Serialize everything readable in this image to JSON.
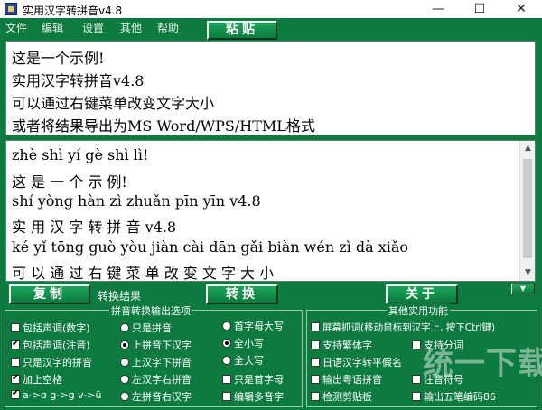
{
  "window": {
    "title": "实用汉字转拼音v4.8",
    "minimize": "—",
    "maximize": "☐",
    "close": "✕"
  },
  "menu": [
    "文件",
    "编辑",
    "设置",
    "其他",
    "帮助"
  ],
  "buttons": {
    "paste": "粘贴",
    "copy": "复制",
    "convert": "转换",
    "about": "关于",
    "dropdown": "▼"
  },
  "input_lines": [
    "这是一个示例!",
    "实用汉字转拼音v4.8",
    "可以通过右键菜单改变文字大小",
    "或者将结果导出为MS Word/WPS/HTML格式"
  ],
  "output_lines": [
    "zhè shì yí gè shì lì!",
    "这  是  一  个  示  例!",
    "shí yòng hàn zì zhuǎn pīn yīn v4.8",
    "实  用   汉  字 转   拼  音  v4.8",
    "ké yǐ tōng guò yòu jiàn cài dān gǎi biàn wén zì dà xiǎo",
    "可 以 通   过  右  键   菜  单  改  变   文  字 大 小"
  ],
  "result_label": "转换结果",
  "options_group": {
    "title": "拼音转换输出选项",
    "col1": [
      {
        "label": "包括声调(数字)",
        "checked": false
      },
      {
        "label": "包括声调(注音)",
        "checked": true
      },
      {
        "label": "只是汉字的拼音",
        "checked": false
      },
      {
        "label": "加上空格",
        "checked": true
      },
      {
        "label": "a->ɑ g->ɡ v->ü",
        "checked": true
      }
    ],
    "col2": [
      {
        "label": "只是拼音",
        "checked": false
      },
      {
        "label": "上拼音下汉字",
        "checked": true
      },
      {
        "label": "上汉字下拼音",
        "checked": false
      },
      {
        "label": "左汉字右拼音",
        "checked": false
      },
      {
        "label": "左拼音右汉字",
        "checked": false
      }
    ],
    "col3": [
      {
        "label": "首字母大写",
        "checked": false,
        "type": "radio"
      },
      {
        "label": "全小写",
        "checked": true,
        "type": "radio"
      },
      {
        "label": "全大写",
        "checked": false,
        "type": "radio"
      },
      {
        "label": "只是首字母",
        "checked": false,
        "type": "check"
      },
      {
        "label": "编辑多音字",
        "checked": false,
        "type": "check"
      }
    ]
  },
  "other_group": {
    "title": "其他实用功能",
    "items": [
      {
        "label": "屏幕抓词(移动鼠标到汉字上, 按下Ctrl键)",
        "checked": false
      },
      {
        "label": "支持繁体字",
        "checked": false
      },
      {
        "label": "支持分词",
        "checked": false
      },
      {
        "label": "日语汉字转平假名",
        "checked": false
      },
      {
        "label": "输出粤语拼音",
        "checked": false
      },
      {
        "label": "注音符号",
        "checked": false
      },
      {
        "label": "检测剪贴板",
        "checked": false
      },
      {
        "label": "输出五笔编码86",
        "checked": false
      }
    ]
  },
  "watermark": "统一下载站"
}
